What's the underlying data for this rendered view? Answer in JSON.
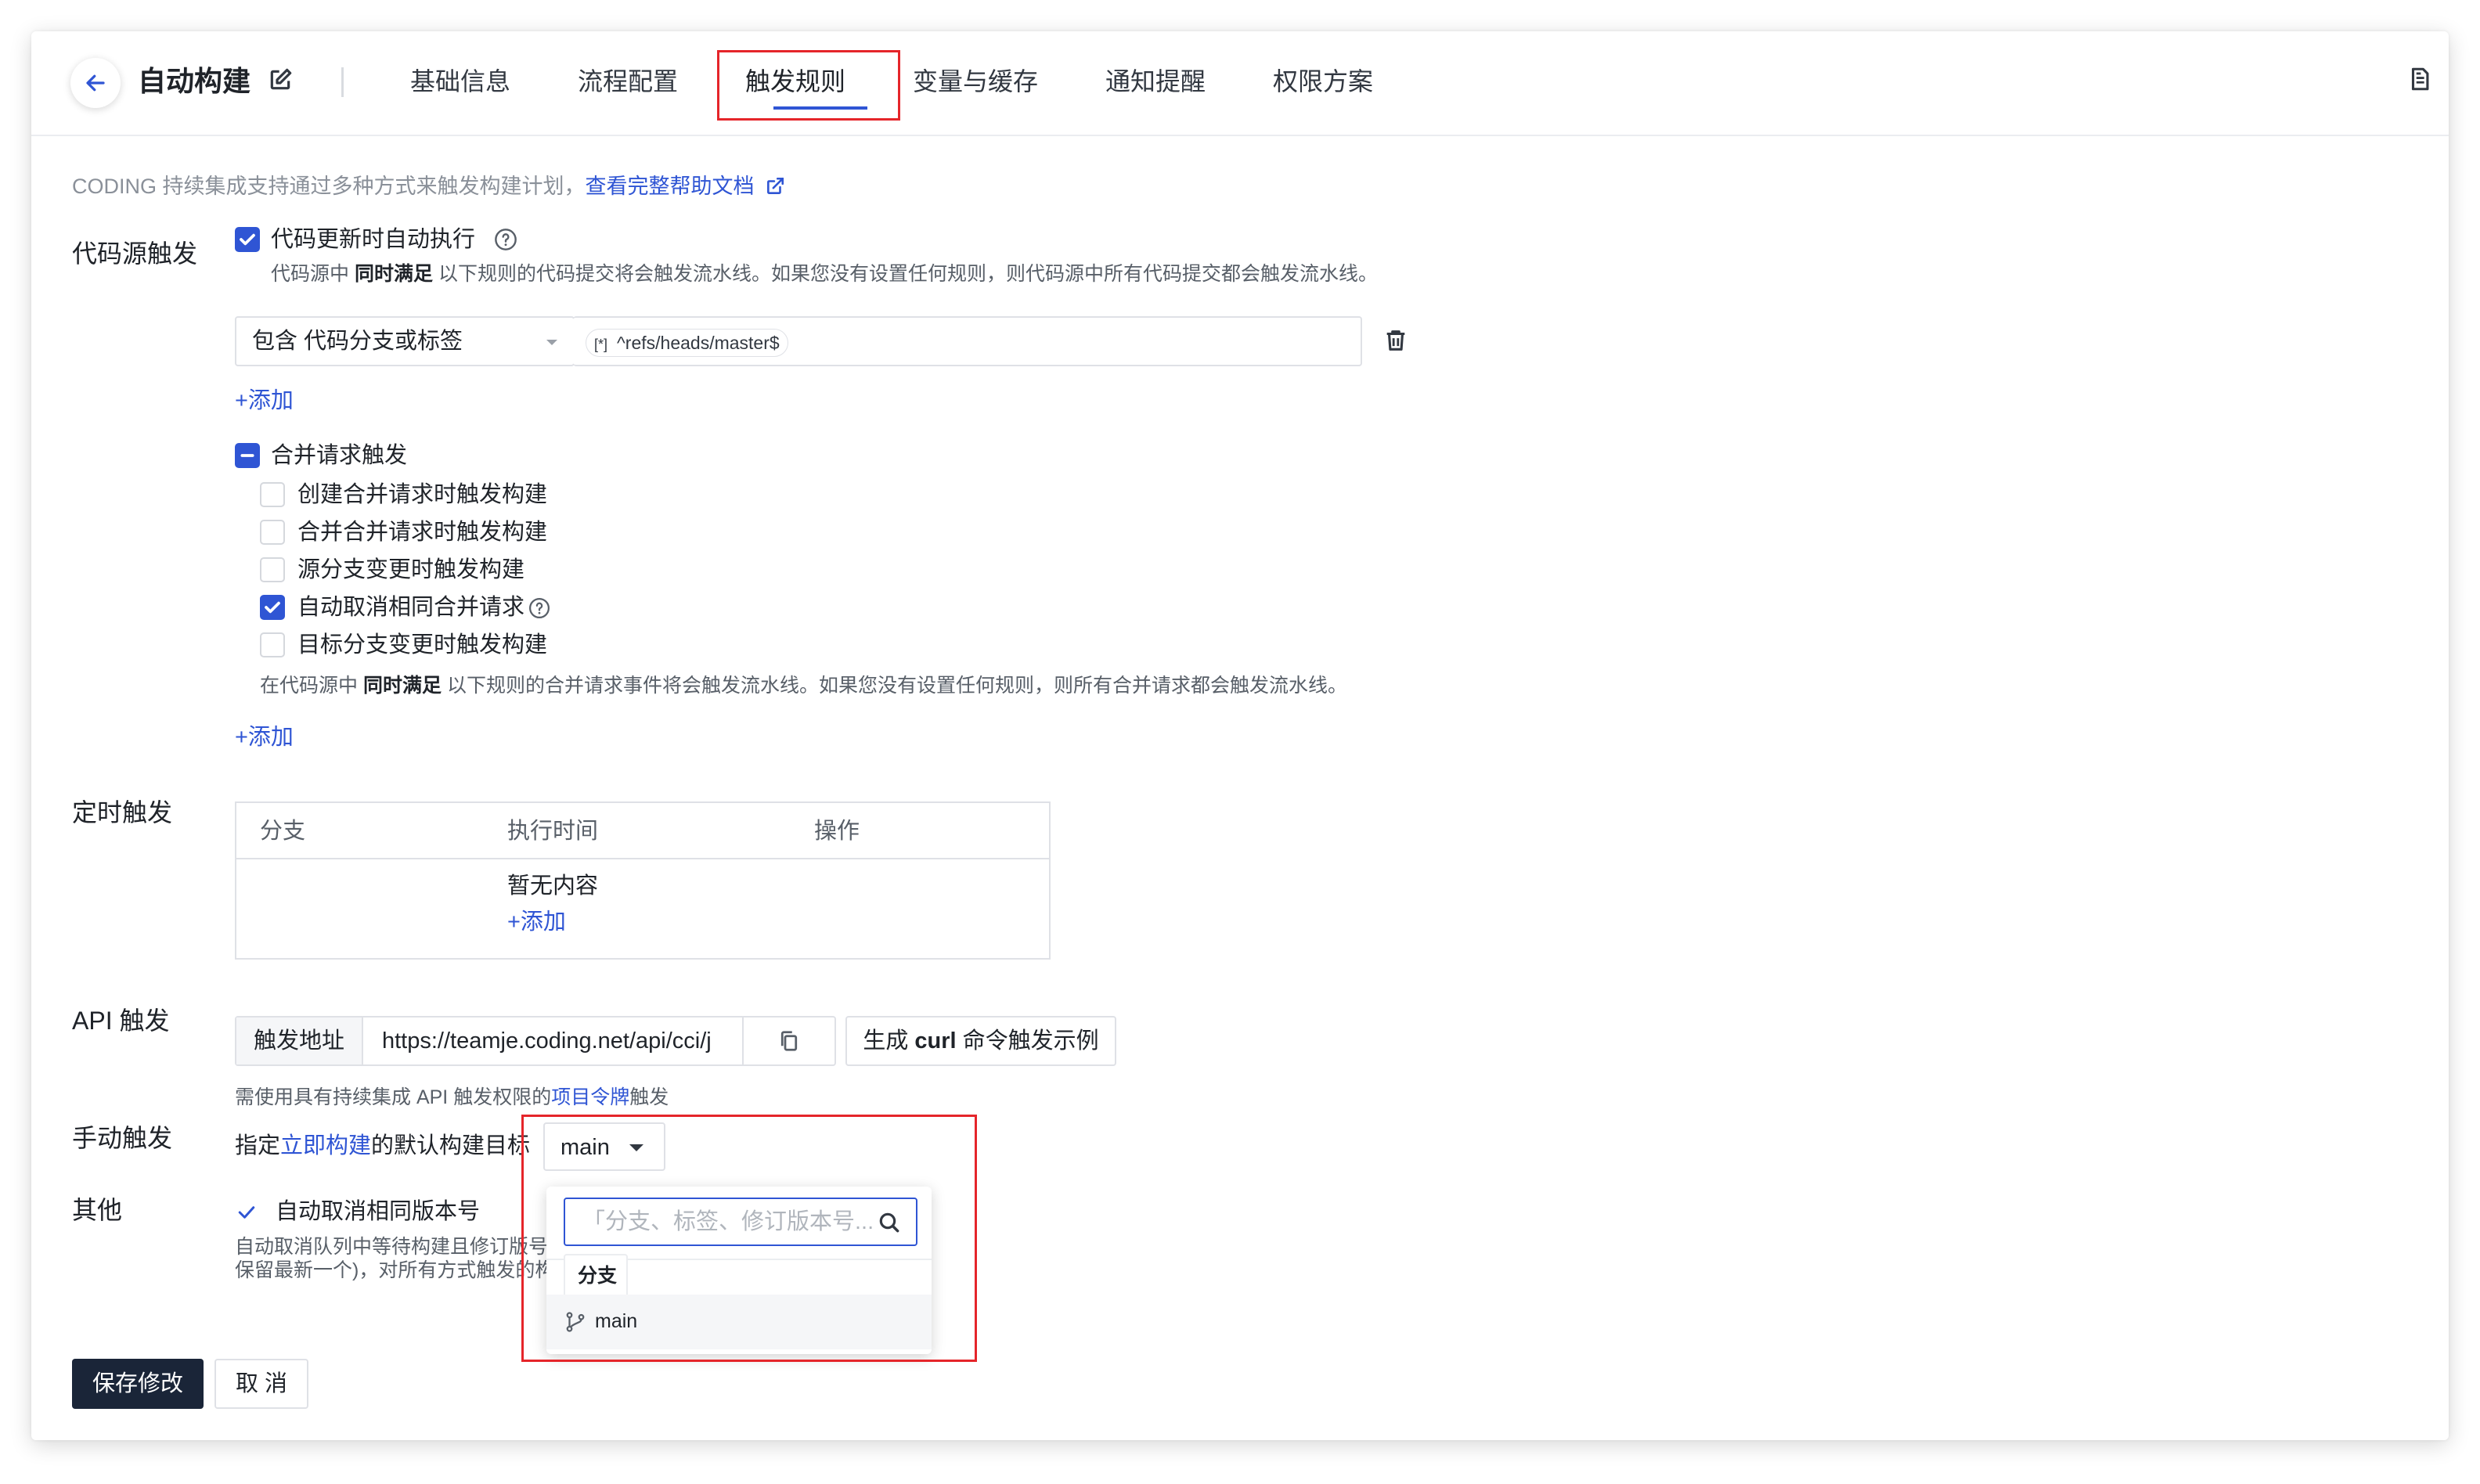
{
  "header": {
    "title": "自动构建",
    "tabs": [
      {
        "label": "基础信息"
      },
      {
        "label": "流程配置"
      },
      {
        "label": "触发规则"
      },
      {
        "label": "变量与缓存"
      },
      {
        "label": "通知提醒"
      },
      {
        "label": "权限方案"
      }
    ],
    "active_tab": "触发规则"
  },
  "intro": {
    "text": "CODING 持续集成支持通过多种方式来触发构建计划，",
    "link": "查看完整帮助文档"
  },
  "code_source": {
    "label": "代码源触发",
    "auto_run_label": "代码更新时自动执行",
    "desc_prefix": "代码源中",
    "desc_bold": "同时满足",
    "desc_suffix": "以下规则的代码提交将会触发流水线。如果您没有设置任何规则，则代码源中所有代码提交都会触发流水线。",
    "rule_select": "包含 代码分支或标签",
    "rule_tag_icon": "[*]",
    "rule_value": "^refs/heads/master$",
    "add_label": "+添加",
    "mr_label": "合并请求触发",
    "mr_options": [
      {
        "label": "创建合并请求时触发构建",
        "checked": false
      },
      {
        "label": "合并合并请求时触发构建",
        "checked": false
      },
      {
        "label": "源分支变更时触发构建",
        "checked": false
      },
      {
        "label": "自动取消相同合并请求",
        "checked": true
      },
      {
        "label": "目标分支变更时触发构建",
        "checked": false
      }
    ],
    "mr_desc_prefix": "在代码源中",
    "mr_desc_bold": "同时满足",
    "mr_desc_suffix": "以下规则的合并请求事件将会触发流水线。如果您没有设置任何规则，则所有合并请求都会触发流水线。",
    "mr_add_label": "+添加"
  },
  "schedule": {
    "label": "定时触发",
    "columns": [
      "分支",
      "执行时间",
      "操作"
    ],
    "empty_text": "暂无内容",
    "add_label": "+添加"
  },
  "api": {
    "label": "API 触发",
    "addon_label": "触发地址",
    "url": "https://teamje.coding.net/api/cci/j",
    "curl_prefix": "生成 ",
    "curl_bold": "curl",
    "curl_suffix": " 命令触发示例",
    "note_prefix": "需使用具有持续集成 API 触发权限的",
    "note_link": "项目令牌",
    "note_suffix": "触发"
  },
  "manual": {
    "label": "手动触发",
    "text_prefix": "指定",
    "text_link": "立即构建",
    "text_suffix": "的默认构建目标",
    "selected": "main"
  },
  "dropdown": {
    "search_placeholder": "「分支、标签、修订版本号...",
    "group_label": "分支",
    "items": [
      "main"
    ]
  },
  "other": {
    "label": "其他",
    "cancel_label": "自动取消相同版本号",
    "desc_line1": "自动取消队列中等待构建且修订版号",
    "desc_line2": "保留最新一个)，对所有方式触发的构"
  },
  "actions": {
    "save": "保存修改",
    "cancel": "取 消"
  },
  "colors": {
    "accent": "#2f55d4",
    "highlight": "#e5252a",
    "primary_button": "#1a2538"
  }
}
